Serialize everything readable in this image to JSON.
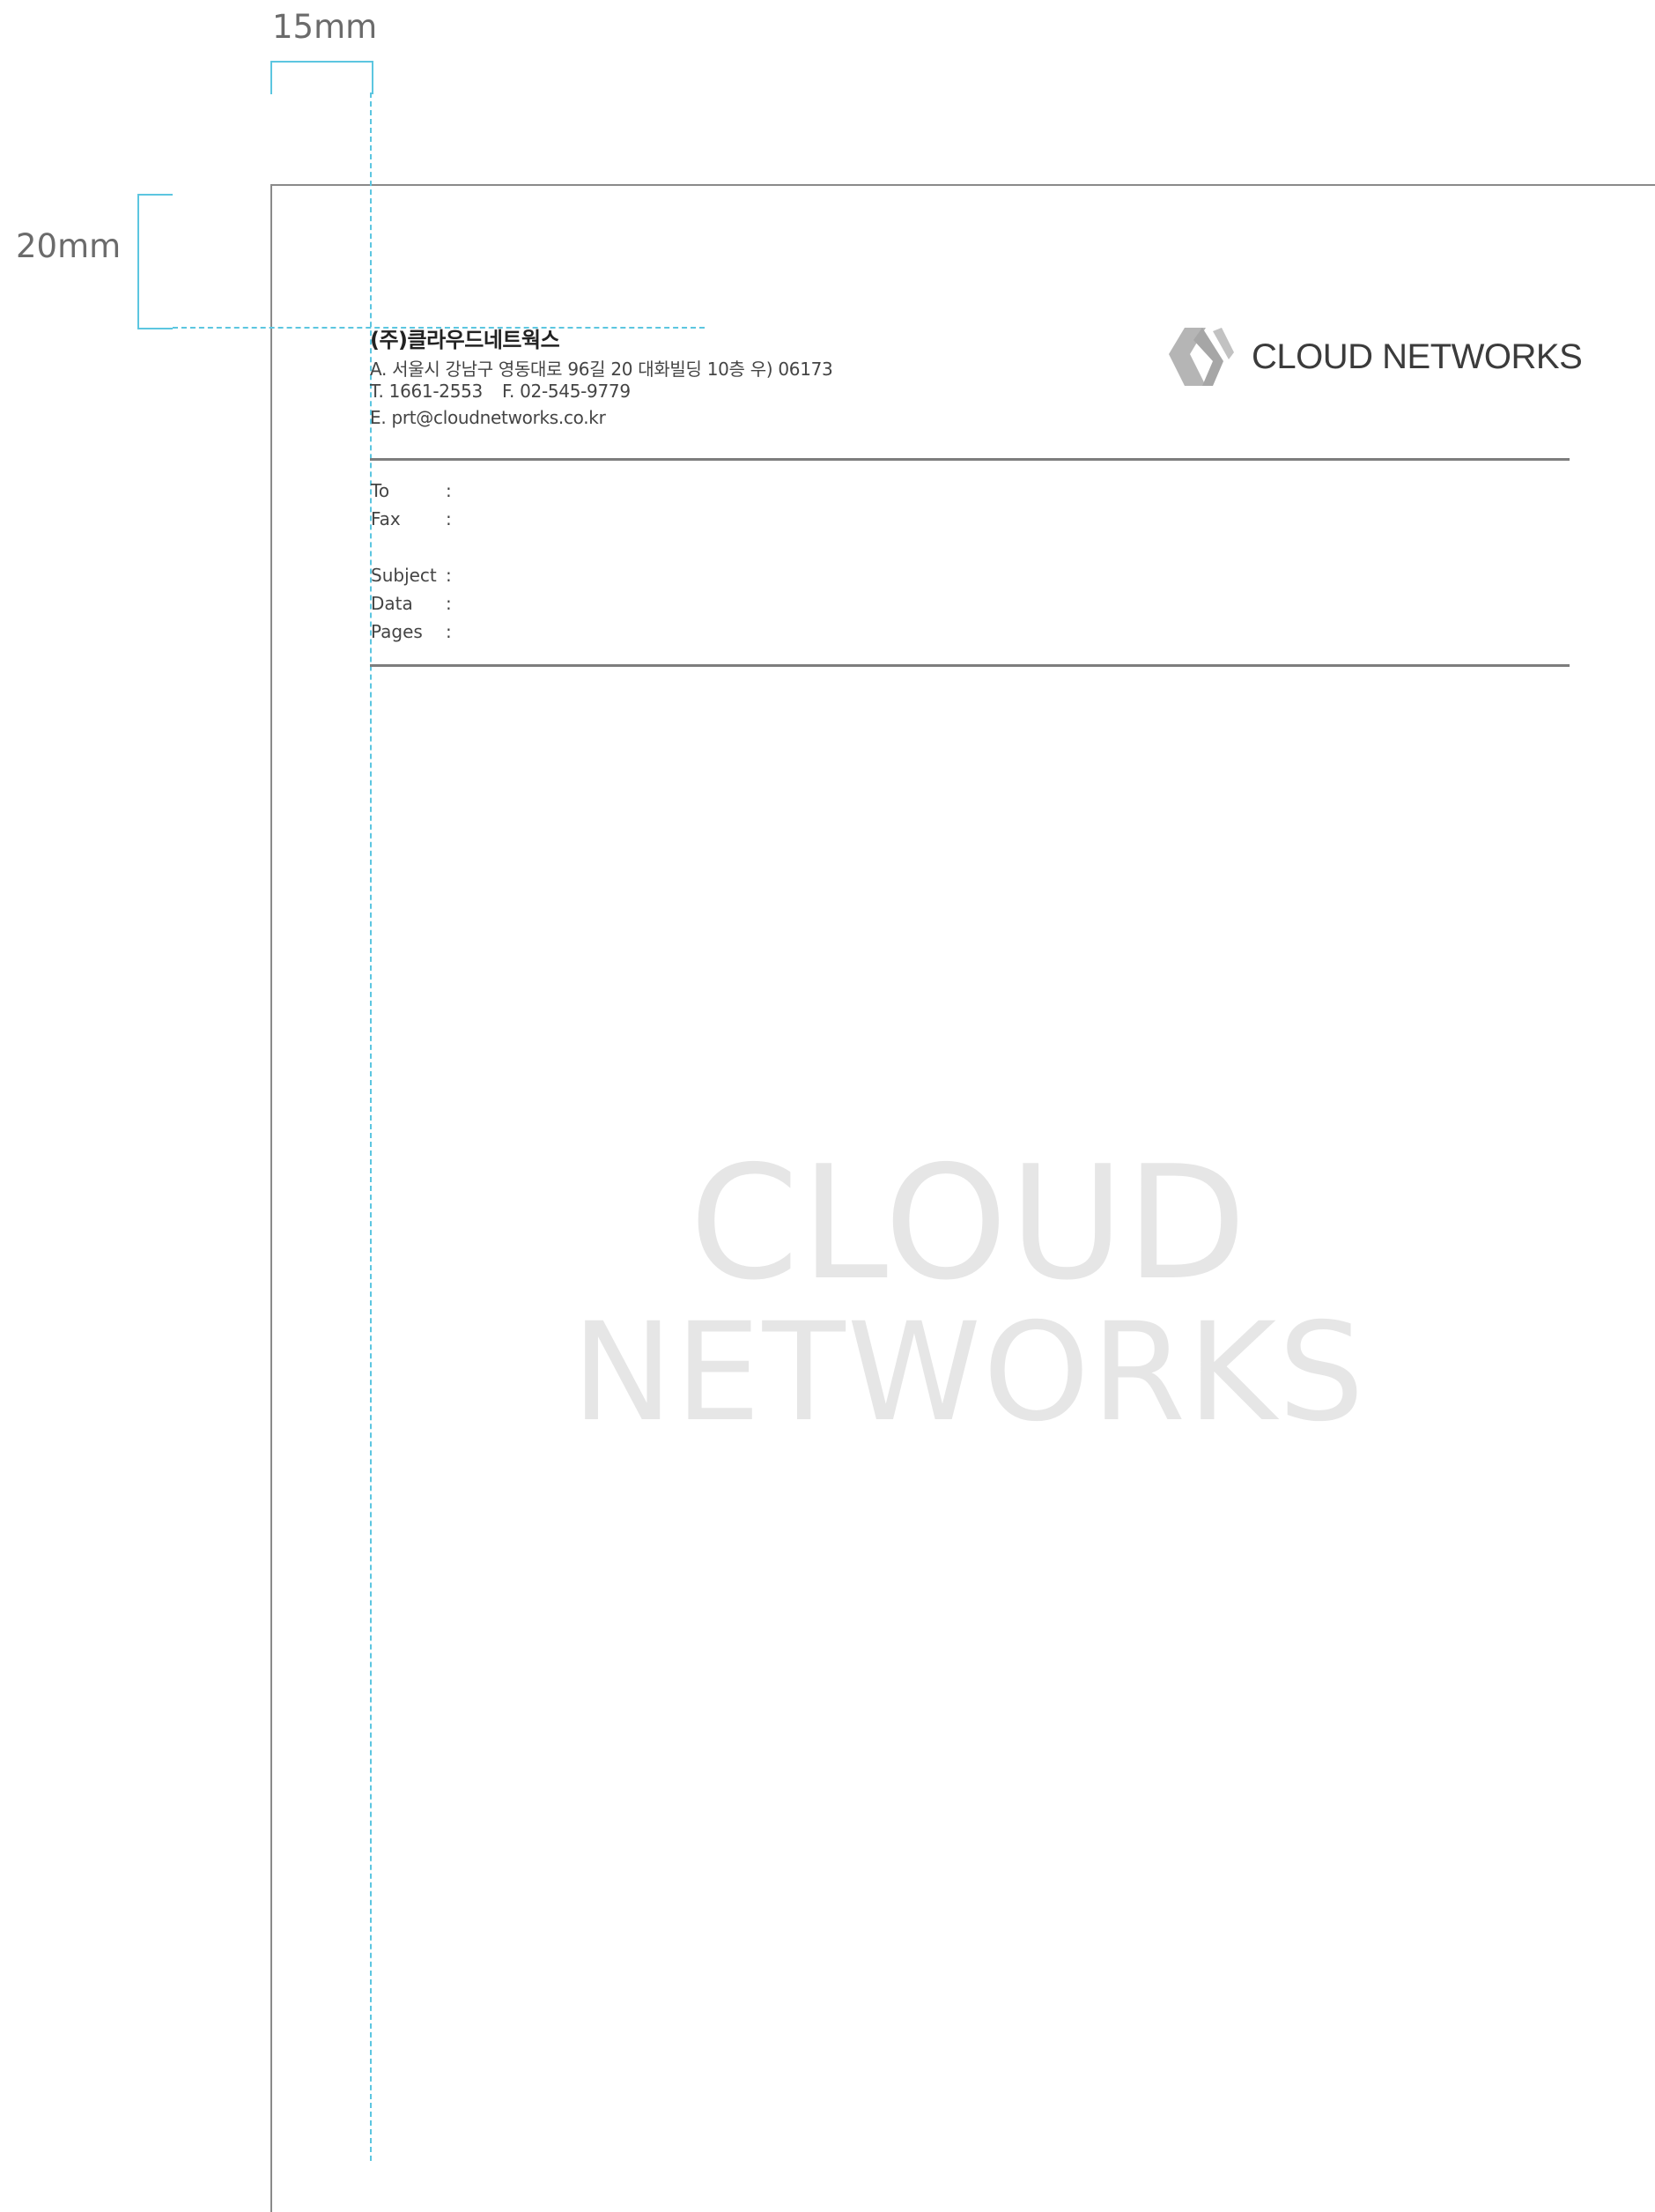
{
  "dimensions": {
    "margin_left": "15mm",
    "margin_top": "20mm"
  },
  "letterhead": {
    "company": "(주)클라우드네트웍스",
    "address": "A. 서울시 강남구 영동대로 96길 20 대화빌딩 10층 우) 06173",
    "phone": "T. 1661-2553",
    "fax": "F. 02-545-9779",
    "email": "E. prt@cloudnetworks.co.kr",
    "logo_text": "CLOUD NETWORKS"
  },
  "fields": [
    {
      "label": "To",
      "sep": ":"
    },
    {
      "label": "Fax",
      "sep": ":"
    },
    {
      "label": "Subject",
      "sep": ":"
    },
    {
      "label": "Data",
      "sep": ":"
    },
    {
      "label": "Pages",
      "sep": ":"
    }
  ],
  "watermark": {
    "line1": "CLOUD",
    "line2": "NETWORKS"
  },
  "colors": {
    "guide": "#5cc6e0",
    "rule": "#7d7d7d",
    "watermark": "#e6e6e6",
    "logo_mark": "#b5b5b5"
  }
}
